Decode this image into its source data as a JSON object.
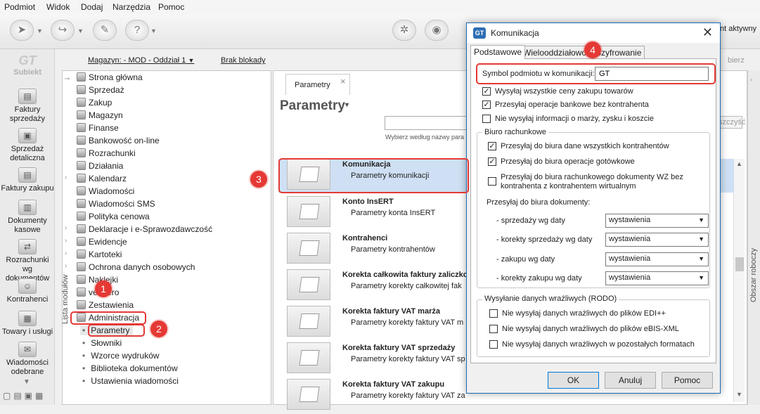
{
  "menu": [
    "Podmiot",
    "Widok",
    "Dodaj",
    "Narzędzia",
    "Pomoc"
  ],
  "app": {
    "logo": "Subiekt",
    "status_text": "nt aktywny",
    "side_right_label": "Obszar roboczy",
    "filter_label": "bierz",
    "clear_label": "szczyść"
  },
  "leftnav": [
    "Faktury sprzedaży",
    "Sprzedaż detaliczna",
    "Faktury zakupu",
    "Dokumenty kasowe",
    "Rozrachunki wg dokumentów",
    "Kontrahenci",
    "Towary i usługi",
    "Wiadomości odebrane"
  ],
  "topstrip": {
    "warehouse": "Magazyn: - MOD - Oddział 1",
    "blockades": "Brak blokady"
  },
  "modules": {
    "vertical_label": "Lista modułów",
    "items": [
      "Strona główna",
      "Sprzedaż",
      "Zakup",
      "Magazyn",
      "Finanse",
      "Bankowość on-line",
      "Rozrachunki",
      "Działania",
      "Kalendarz",
      "Wiadomości",
      "Wiadomości SMS",
      "Polityka cenowa",
      "Deklaracje i e-Sprawozdawczość",
      "Ewidencje",
      "Kartoteki",
      "Ochrona danych osobowych",
      "Naklejki",
      "vendero",
      "Zestawienia",
      "Administracja"
    ],
    "subitems": [
      "Parametry",
      "Słowniki",
      "Wzorce wydruków",
      "Biblioteka dokumentów",
      "Ustawienia wiadomości"
    ]
  },
  "main": {
    "tab_label": "Parametry",
    "title": "Parametry",
    "search_hint": "Wybierz według nazwy para",
    "rows": [
      {
        "title": "Komunikacja",
        "sub": "Parametry komunikacji"
      },
      {
        "title": "Konto InsERT",
        "sub": "Parametry konta InsERT"
      },
      {
        "title": "Kontrahenci",
        "sub": "Parametry kontrahentów"
      },
      {
        "title": "Korekta całkowita faktury zaliczko",
        "sub": "Parametry korekty całkowitej fak"
      },
      {
        "title": "Korekta faktury VAT marża",
        "sub": "Parametry korekty faktury VAT m"
      },
      {
        "title": "Korekta faktury VAT sprzedaży",
        "sub": "Parametry korekty faktury VAT sp"
      },
      {
        "title": "Korekta faktury VAT zakupu",
        "sub": "Parametry korekty faktury VAT za"
      }
    ]
  },
  "dialog": {
    "title": "Komunikacja",
    "tabs": [
      "Podstawowe",
      "Wielooddziałowość",
      "Szyfrowanie"
    ],
    "symbol_label": "Symbol podmiotu w komunikacji:",
    "symbol_value": "GT",
    "top_checks": [
      {
        "label": "Wysyłaj wszystkie ceny zakupu towarów",
        "checked": true
      },
      {
        "label": "Przesyłaj operacje bankowe bez kontrahenta",
        "checked": true
      },
      {
        "label": "Nie wysyłaj informacji o marży, zysku i koszcie",
        "checked": false
      }
    ],
    "biuro_legend": "Biuro rachunkowe",
    "biuro_checks": [
      {
        "label": "Przesyłaj do biura dane wszystkich kontrahentów",
        "checked": true
      },
      {
        "label": "Przesyłaj do biura operacje gotówkowe",
        "checked": true
      },
      {
        "label": "Przesyłaj do biura rachunkowego dokumenty WZ bez",
        "label2": "kontrahenta z kontrahentem wirtualnym",
        "checked": false
      }
    ],
    "docs_heading": "Przesyłaj do biura dokumenty:",
    "selects": [
      {
        "label": "- sprzedaży wg daty",
        "value": "wystawienia"
      },
      {
        "label": "- korekty sprzedaży wg daty",
        "value": "wystawienia"
      },
      {
        "label": "- zakupu wg daty",
        "value": "wystawienia"
      },
      {
        "label": "- korekty zakupu wg daty",
        "value": "wystawienia"
      }
    ],
    "rodo_legend": "Wysyłanie danych wrażliwych (RODO)",
    "rodo_checks": [
      {
        "label": "Nie wysyłaj danych wrażliwych do plików EDI++",
        "checked": false
      },
      {
        "label": "Nie wysyłaj danych wrażliwych do plików eBIS-XML",
        "checked": false
      },
      {
        "label": "Nie wysyłaj danych wrażliwych w pozostałych formatach",
        "checked": false
      }
    ],
    "buttons": {
      "ok": "OK",
      "cancel": "Anuluj",
      "help": "Pomoc"
    }
  },
  "markers": [
    "1",
    "2",
    "3",
    "4"
  ],
  "accent": "#e53935"
}
